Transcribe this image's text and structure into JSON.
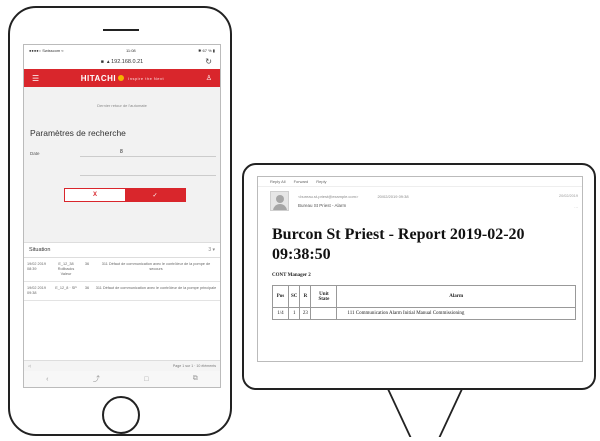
{
  "phone": {
    "status": {
      "carrier": "●●●●○ Swisscom ≈",
      "time": "11:08",
      "battery": "✱ 67 % ▮"
    },
    "url": {
      "lock_icon": "lock-icon",
      "host": "▴ 192.168.0.21"
    },
    "brand": {
      "name": "HITACHI",
      "tagline": "Inspire the Next"
    },
    "caption": "Dernier retour de l'automate",
    "params_title": "Paramètres de recherche",
    "field_label": "Date",
    "field_value": "8",
    "buttons": {
      "cancel": "X",
      "ok": "✓"
    },
    "situation": {
      "title": "Situation",
      "count": "3 ▾"
    },
    "alarms": [
      {
        "date": "19/02 2019 08:39",
        "code": "E_12_38 Rollbacks Valeur",
        "n": "36",
        "desc": "311 Défaut de communication avec le contrôleur de la pompe de secours"
      },
      {
        "date": "19/02 2019 09:38",
        "code": "E_12_8 · SP",
        "n": "36",
        "desc": "311 Défaut de communication avec le contrôleur de la pompe principale"
      }
    ],
    "footer": {
      "left": "◁",
      "right": "Page 1 sur 1 · 10 éléments"
    },
    "toolbar": [
      "‹",
      "⤴",
      "□",
      "⧉"
    ]
  },
  "monitor": {
    "toolbar": [
      "Reply All",
      "Forward",
      "Reply"
    ],
    "from": "<bureau.st-priest@example.com>",
    "date": "20/02/2019 09:38",
    "subject": "Bureau St Priest - Alarm",
    "right_meta": "20/02/2019",
    "title": "Burcon St Priest - Report 2019-02-20 09:38:50",
    "subtitle": "CONT Manager 2",
    "table": {
      "headers": [
        "Pos",
        "SC",
        "R",
        "Unit State",
        "Alarm"
      ],
      "rows": [
        [
          "1/4",
          "1",
          "23",
          "",
          "111 Communication Alarm Initial Manual Commissioning"
        ]
      ]
    }
  }
}
